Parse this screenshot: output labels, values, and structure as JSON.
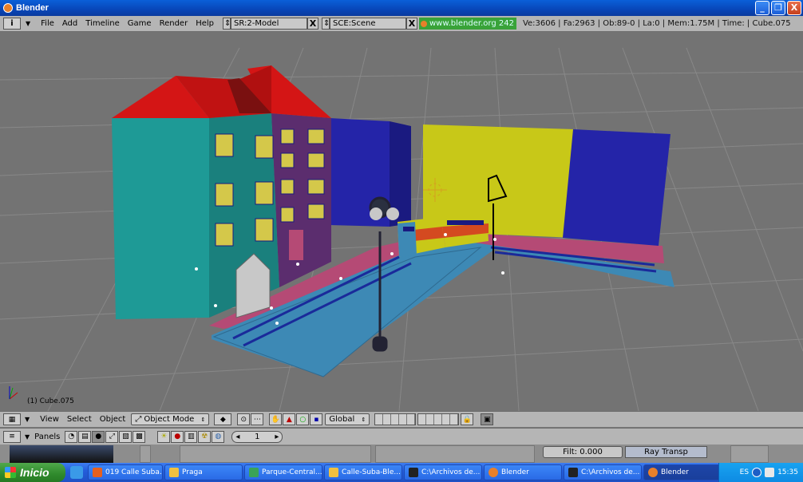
{
  "window": {
    "title": "Blender",
    "buttons": {
      "minimize": "_",
      "maximize": "❐",
      "close": "X"
    }
  },
  "header": {
    "info_icon": "i",
    "menus": [
      "File",
      "Add",
      "Timeline",
      "Game",
      "Render",
      "Help"
    ],
    "screen": "SR:2-Model",
    "scene": "SCE:Scene",
    "close": "X",
    "website": "www.blender.org 242",
    "stats": "Ve:3606 | Fa:2963 | Ob:89-0 | La:0 | Mem:1.75M | Time: | Cube.075"
  },
  "viewport": {
    "selected_object": "(1) Cube.075"
  },
  "view_header": {
    "menus": [
      "View",
      "Select",
      "Object"
    ],
    "mode": "Object Mode",
    "orientation": "Global"
  },
  "panels_header": {
    "label": "Panels",
    "frame": "1"
  },
  "buttons_area": {
    "filt": "Filt: 0.000",
    "ray_transp": "Ray Transp"
  },
  "taskbar": {
    "start": "Inicio",
    "tasks": [
      {
        "label": "019 Calle Suba...",
        "color": "#e5601f"
      },
      {
        "label": "Praga",
        "color": "#f0c040"
      },
      {
        "label": "Parque-Central...",
        "color": "#3aa357"
      },
      {
        "label": "Calle-Suba-Ble...",
        "color": "#f0c040"
      },
      {
        "label": "C:\\Archivos de...",
        "color": "#222222"
      },
      {
        "label": "Blender",
        "color": "#e8802a"
      },
      {
        "label": "C:\\Archivos de...",
        "color": "#222222"
      },
      {
        "label": "Blender",
        "color": "#e8802a"
      }
    ],
    "language": "ES",
    "clock": "15:35"
  },
  "colors": {
    "roof": "#d41515",
    "teal_building": "#1e9a96",
    "purple_building": "#5b2d6e",
    "blue_wall": "#2424a8",
    "yellow_wall": "#c8c818",
    "street": "#3d89b5",
    "sidewalk": "#b54a75"
  }
}
